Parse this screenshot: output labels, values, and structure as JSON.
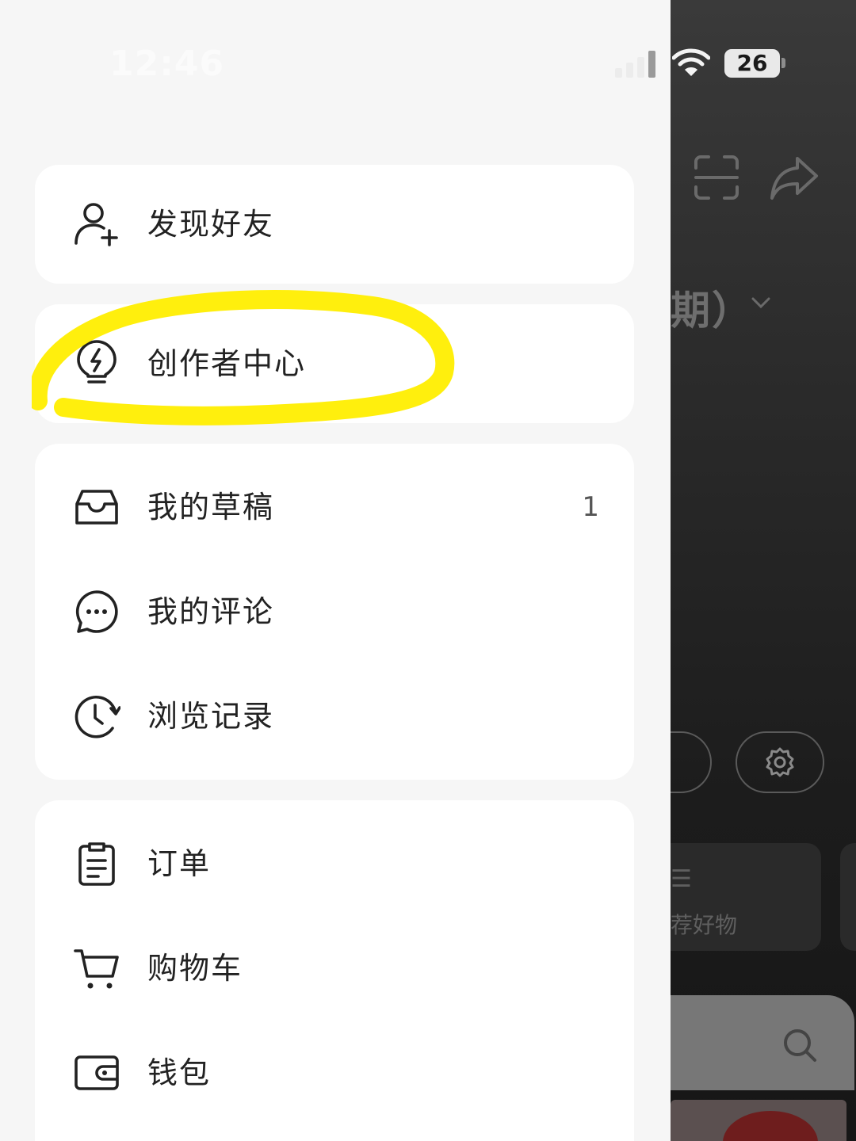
{
  "status_bar": {
    "time": "12:46",
    "battery_level": "26"
  },
  "drawer": {
    "group1": [
      {
        "label": "发现好友",
        "icon": "add-user-icon"
      }
    ],
    "group2": [
      {
        "label": "创作者中心",
        "icon": "lightbulb-bolt-icon",
        "highlighted": true
      }
    ],
    "group3": [
      {
        "label": "我的草稿",
        "icon": "inbox-tray-icon",
        "count": "1"
      },
      {
        "label": "我的评论",
        "icon": "chat-bubble-icon"
      },
      {
        "label": "浏览记录",
        "icon": "history-clock-icon"
      }
    ],
    "group4": [
      {
        "label": "订单",
        "icon": "clipboard-icon"
      },
      {
        "label": "购物车",
        "icon": "cart-icon"
      },
      {
        "label": "钱包",
        "icon": "wallet-icon"
      }
    ]
  },
  "background": {
    "title_fragment": "期）",
    "card_text": "荐好物",
    "highlight_color": "#ffee00"
  }
}
